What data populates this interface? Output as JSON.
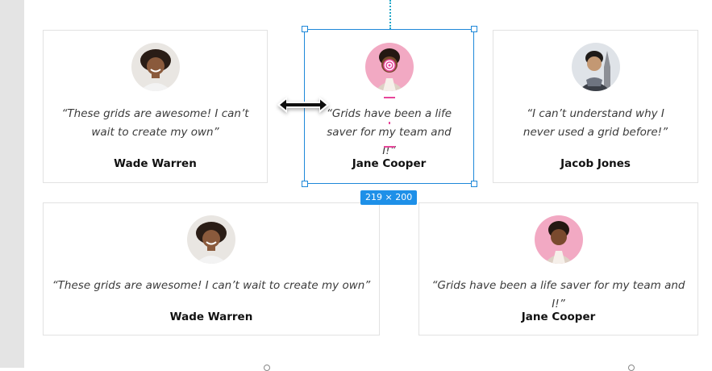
{
  "selection": {
    "dimensions": "219 × 200"
  },
  "cards": [
    {
      "quote": "“These grids are awesome! I can’t wait to create my own”",
      "name": "Wade Warren"
    },
    {
      "quote": "“Grids have been a life saver for my team and I!”",
      "name": "Jane Cooper"
    },
    {
      "quote": "“I can’t understand why I never used a grid before!”",
      "name": "Jacob Jones"
    },
    {
      "quote": "“These grids are awesome! I can’t wait to create my own”",
      "name": "Wade Warren"
    },
    {
      "quote": "“Grids have been a life saver for my team and I!”",
      "name": "Jane Cooper"
    }
  ],
  "icons": [
    "avatar-photo",
    "resize-horizontal-cursor",
    "target-icon"
  ],
  "colors": {
    "selection": "#1e88d9",
    "badge": "#1e90e8",
    "accent_pink": "#e7469a",
    "guide": "#22a7c8"
  }
}
